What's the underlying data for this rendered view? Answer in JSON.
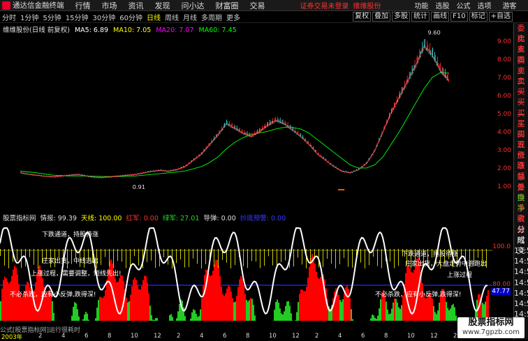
{
  "app": {
    "name": "通达信金融终端",
    "alert": "证券交易未登录",
    "stock_name_top": "维维股份"
  },
  "menus": [
    "行情",
    "市场",
    "资讯",
    "发现",
    "问小达",
    "财富圈",
    "交易"
  ],
  "top_right": [
    "功能",
    "选股",
    "公式",
    "选项",
    "游客"
  ],
  "periods": [
    "分时",
    "1分钟",
    "5分钟",
    "15分钟",
    "30分钟",
    "60分钟",
    "日线",
    "周线",
    "月线",
    "多周期",
    "更多"
  ],
  "active_period": "日线",
  "tools": [
    "复权",
    "叠加",
    "多股",
    "统计",
    "画线",
    "F10",
    "标记",
    "+自选"
  ],
  "main_legend": {
    "stock": "维维股份(日线 前复权)",
    "ma5": "MA5: 6.89",
    "ma10": "MA10: 7.05",
    "ma20": "MA20: 7.07",
    "ma60": "MA60: 7.45"
  },
  "price_labels": [
    "9.00",
    "8.00",
    "7.00",
    "6.00",
    "5.00",
    "4.00",
    "3.00",
    "2.00",
    "1.00"
  ],
  "peak_label": "9.60",
  "low_label": "0.91",
  "right_panel": [
    {
      "t": "委比",
      "c": "red"
    },
    {
      "t": "卖五",
      "c": "red"
    },
    {
      "t": "卖四",
      "c": "red"
    },
    {
      "t": "卖三",
      "c": "red"
    },
    {
      "t": "卖二",
      "c": "red"
    },
    {
      "t": "卖一",
      "c": "red"
    },
    {
      "t": "买一",
      "c": "red"
    },
    {
      "t": "买二",
      "c": "red"
    },
    {
      "t": "买三",
      "c": "red"
    },
    {
      "t": "买四",
      "c": "red"
    },
    {
      "t": "买五",
      "c": "red"
    },
    {
      "t": "现价",
      "c": "red"
    },
    {
      "t": "涨跌",
      "c": "red"
    },
    {
      "t": "涨幅",
      "c": "red"
    },
    {
      "t": "总量",
      "c": "red"
    },
    {
      "t": "外盘",
      "c": "red"
    },
    {
      "t": "换手",
      "c": "green"
    },
    {
      "t": "净资",
      "c": "red"
    },
    {
      "t": "收益",
      "c": "red"
    },
    {
      "t": "分时",
      "c": "white"
    },
    {
      "t": "成交",
      "c": "white"
    },
    {
      "t": "14:5",
      "c": "white"
    },
    {
      "t": "14:5",
      "c": "white"
    },
    {
      "t": "14:5",
      "c": "white"
    },
    {
      "t": "14:5",
      "c": "white"
    },
    {
      "t": "14:5",
      "c": "white"
    },
    {
      "t": "14:5",
      "c": "white"
    },
    {
      "t": "14:5",
      "c": "white"
    }
  ],
  "ind_legend": {
    "name": "股票指标网",
    "qingbao": "情报: 99.39",
    "tianxian": "天线: 100.00",
    "hongjun": "红军: 0.00",
    "lvjun": "绿军: 27.01",
    "daodan": "导弹: 0.00",
    "extra": "抄底预警: 0.00"
  },
  "ind_axis": [
    "100.0",
    "80.00",
    "47.77"
  ],
  "ind_texts": [
    "下跌通道，持股待涨",
    "庄家出货，中线逃出",
    "上涨过程，需要调整，短线先出!",
    "不必杀跌，应有小反弹,跌得深!"
  ],
  "ind_texts_right": [
    "下跌通道，持股待涨",
    "庄家出货，大盘走势中逃跑出",
    "上涨过程",
    "不必杀跌，应有小反弹,跌得深!"
  ],
  "formula_bar": "公式[股票指标网]运行很耗时",
  "date_labels": [
    "2003年",
    "2",
    "4",
    "6",
    "8",
    "10",
    "12",
    "2",
    "4",
    "6",
    "8",
    "10",
    "12",
    "2",
    "4",
    "6",
    "8",
    "10",
    "12",
    "2",
    "4"
  ],
  "watermark": {
    "line1": "股票指标网",
    "line2": "www.7gpzb.com"
  },
  "colors": {
    "up": "#ff3030",
    "down": "#00ffff",
    "ma5": "#ffffff",
    "ma10": "#ffff00",
    "ma20": "#ff00ff",
    "ma60": "#00ff00",
    "ind_red": "#ff0000",
    "ind_green": "#22cc22",
    "ind_yellow": "#ffff00",
    "ind_blue": "#1a1aff"
  },
  "chart_data": {
    "type": "line",
    "title": "维维股份(日线 前复权)",
    "y_range": [
      0.5,
      10.2
    ],
    "close": [
      1.2,
      1.1,
      1.05,
      0.98,
      0.95,
      1.0,
      1.05,
      1.1,
      1.0,
      0.92,
      0.91,
      0.95,
      1.0,
      1.05,
      1.1,
      1.2,
      1.3,
      1.35,
      1.3,
      1.4,
      1.6,
      2.0,
      2.4,
      3.0,
      3.6,
      4.3,
      4.0,
      3.7,
      3.5,
      3.8,
      4.2,
      4.5,
      4.3,
      3.9,
      3.5,
      3.0,
      2.4,
      2.0,
      1.6,
      1.3,
      1.2,
      1.4,
      1.8,
      2.6,
      3.8,
      5.0,
      6.0,
      7.0,
      8.0,
      9.2,
      8.6,
      7.6,
      7.0
    ],
    "ma60": [
      1.3,
      1.25,
      1.2,
      1.12,
      1.05,
      1.02,
      1.0,
      1.0,
      1.0,
      0.98,
      0.97,
      0.96,
      0.97,
      0.98,
      1.0,
      1.05,
      1.1,
      1.15,
      1.2,
      1.25,
      1.32,
      1.45,
      1.6,
      1.85,
      2.2,
      2.7,
      3.1,
      3.4,
      3.6,
      3.7,
      3.8,
      3.95,
      4.05,
      4.05,
      3.95,
      3.7,
      3.3,
      2.9,
      2.5,
      2.1,
      1.7,
      1.5,
      1.5,
      1.7,
      2.2,
      3.0,
      3.8,
      4.7,
      5.6,
      6.5,
      7.2,
      7.5,
      7.45
    ]
  }
}
